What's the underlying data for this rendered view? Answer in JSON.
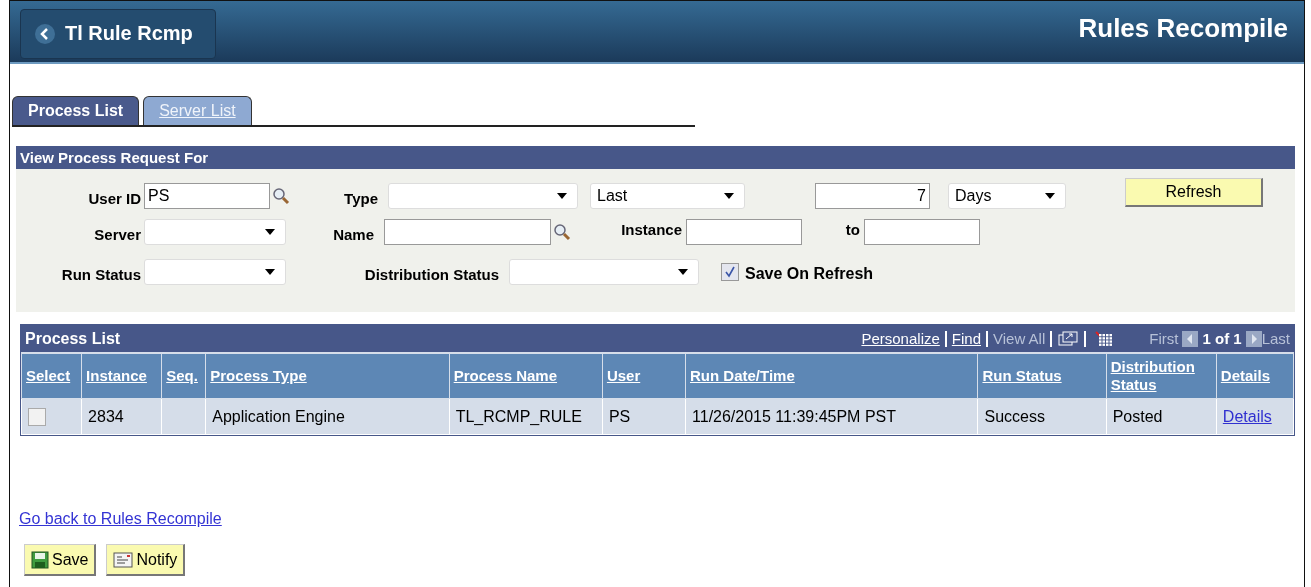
{
  "header": {
    "back_label": "Tl Rule Rcmp",
    "title": "Rules Recompile"
  },
  "tabs": [
    {
      "label": "Process List",
      "selected": true
    },
    {
      "label": "Server List",
      "selected": false
    }
  ],
  "filter_panel": {
    "title": "View Process Request For",
    "user_id": {
      "label": "User ID",
      "value": "PS"
    },
    "type": {
      "label": "Type"
    },
    "range": {
      "value": "Last"
    },
    "count": {
      "value": "7"
    },
    "unit": {
      "value": "Days"
    },
    "refresh_button": "Refresh",
    "server": {
      "label": "Server"
    },
    "name": {
      "label": "Name"
    },
    "instance": {
      "label": "Instance"
    },
    "to": {
      "label": "to"
    },
    "run_status": {
      "label": "Run Status"
    },
    "distribution_status": {
      "label": "Distribution Status"
    },
    "save_on_refresh": {
      "label": "Save On Refresh",
      "checked": true
    }
  },
  "grid": {
    "title": "Process List",
    "links": [
      "Personalize",
      "Find"
    ],
    "view_all": "View All",
    "pager": {
      "first": "First",
      "count": "1 of 1",
      "last": "Last"
    },
    "columns": [
      "Select",
      "Instance",
      "Seq.",
      "Process Type",
      "Process Name",
      "User",
      "Run Date/Time",
      "Run Status",
      "Distribution Status",
      "Details"
    ],
    "rows": [
      {
        "selected": false,
        "cells": [
          "",
          "2834",
          "",
          "Application Engine",
          "TL_RCMP_RULE",
          "PS",
          "11/26/2015 11:39:45PM PST",
          "Success",
          "Posted",
          "Details"
        ]
      }
    ]
  },
  "back_link": "Go back to Rules Recompile",
  "buttons": [
    {
      "kind": "save",
      "label": "Save"
    },
    {
      "kind": "notify",
      "label": "Notify"
    }
  ]
}
